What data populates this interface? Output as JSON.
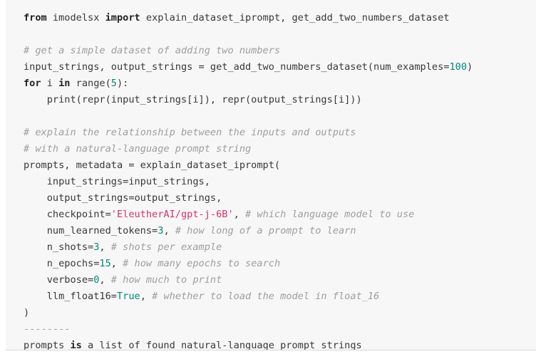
{
  "panel": {
    "background_color": "#f7f7f7",
    "page_background_color": "#ffffff",
    "border_color": "#d8d8d8",
    "language": "python"
  },
  "theme": {
    "text_color": "#383838",
    "keyword_color": "#222222",
    "string_color": "#d6336c",
    "number_color": "#00897b",
    "boolean_color": "#00897b",
    "comment_color": "#9e9e9e"
  },
  "code": {
    "lines": [
      {
        "index": 1,
        "text": "from imodelsx import explain_dataset_iprompt, get_add_two_numbers_dataset",
        "tokens": [
          {
            "t": "from",
            "k": "kw"
          },
          {
            "t": " imodelsx ",
            "k": "nm"
          },
          {
            "t": "import",
            "k": "kw"
          },
          {
            "t": " explain_dataset_iprompt, get_add_two_numbers_dataset",
            "k": "nm"
          }
        ]
      },
      {
        "index": 2,
        "text": "",
        "tokens": []
      },
      {
        "index": 3,
        "text": "# get a simple dataset of adding two numbers",
        "tokens": [
          {
            "t": "# get a simple dataset of adding two numbers",
            "k": "cmt"
          }
        ]
      },
      {
        "index": 4,
        "text": "input_strings, output_strings = get_add_two_numbers_dataset(num_examples=100)",
        "tokens": [
          {
            "t": "input_strings, output_strings = get_add_two_numbers_dataset(num_examples=",
            "k": "nm"
          },
          {
            "t": "100",
            "k": "num"
          },
          {
            "t": ")",
            "k": "nm"
          }
        ]
      },
      {
        "index": 5,
        "text": "for i in range(5):",
        "tokens": [
          {
            "t": "for",
            "k": "kw"
          },
          {
            "t": " i ",
            "k": "nm"
          },
          {
            "t": "in",
            "k": "kw"
          },
          {
            "t": " range(",
            "k": "nm"
          },
          {
            "t": "5",
            "k": "num"
          },
          {
            "t": "):",
            "k": "nm"
          }
        ]
      },
      {
        "index": 6,
        "text": "    print(repr(input_strings[i]), repr(output_strings[i]))",
        "tokens": [
          {
            "t": "    print(repr(input_strings[i]), repr(output_strings[i]))",
            "k": "nm"
          }
        ]
      },
      {
        "index": 7,
        "text": "",
        "tokens": []
      },
      {
        "index": 8,
        "text": "# explain the relationship between the inputs and outputs",
        "tokens": [
          {
            "t": "# explain the relationship between the inputs and outputs",
            "k": "cmt"
          }
        ]
      },
      {
        "index": 9,
        "text": "# with a natural-language prompt string",
        "tokens": [
          {
            "t": "# with a natural-language prompt string",
            "k": "cmt"
          }
        ]
      },
      {
        "index": 10,
        "text": "prompts, metadata = explain_dataset_iprompt(",
        "tokens": [
          {
            "t": "prompts, metadata = explain_dataset_iprompt(",
            "k": "nm"
          }
        ]
      },
      {
        "index": 11,
        "text": "    input_strings=input_strings,",
        "tokens": [
          {
            "t": "    input_strings=input_strings,",
            "k": "nm"
          }
        ]
      },
      {
        "index": 12,
        "text": "    output_strings=output_strings,",
        "tokens": [
          {
            "t": "    output_strings=output_strings,",
            "k": "nm"
          }
        ]
      },
      {
        "index": 13,
        "text": "    checkpoint='EleutherAI/gpt-j-6B', # which language model to use",
        "tokens": [
          {
            "t": "    checkpoint=",
            "k": "nm"
          },
          {
            "t": "'EleutherAI/gpt-j-6B'",
            "k": "str"
          },
          {
            "t": ", ",
            "k": "nm"
          },
          {
            "t": "# which language model to use",
            "k": "cmt"
          }
        ]
      },
      {
        "index": 14,
        "text": "    num_learned_tokens=3, # how long of a prompt to learn",
        "tokens": [
          {
            "t": "    num_learned_tokens=",
            "k": "nm"
          },
          {
            "t": "3",
            "k": "num"
          },
          {
            "t": ", ",
            "k": "nm"
          },
          {
            "t": "# how long of a prompt to learn",
            "k": "cmt"
          }
        ]
      },
      {
        "index": 15,
        "text": "    n_shots=3, # shots per example",
        "tokens": [
          {
            "t": "    n_shots=",
            "k": "nm"
          },
          {
            "t": "3",
            "k": "num"
          },
          {
            "t": ", ",
            "k": "nm"
          },
          {
            "t": "# shots per example",
            "k": "cmt"
          }
        ]
      },
      {
        "index": 16,
        "text": "    n_epochs=15, # how many epochs to search",
        "tokens": [
          {
            "t": "    n_epochs=",
            "k": "nm"
          },
          {
            "t": "15",
            "k": "num"
          },
          {
            "t": ", ",
            "k": "nm"
          },
          {
            "t": "# how many epochs to search",
            "k": "cmt"
          }
        ]
      },
      {
        "index": 17,
        "text": "    verbose=0, # how much to print",
        "tokens": [
          {
            "t": "    verbose=",
            "k": "nm"
          },
          {
            "t": "0",
            "k": "num"
          },
          {
            "t": ", ",
            "k": "nm"
          },
          {
            "t": "# how much to print",
            "k": "cmt"
          }
        ]
      },
      {
        "index": 18,
        "text": "    llm_float16=True, # whether to load the model in float_16",
        "tokens": [
          {
            "t": "    llm_float16=",
            "k": "nm"
          },
          {
            "t": "True",
            "k": "bln"
          },
          {
            "t": ", ",
            "k": "nm"
          },
          {
            "t": "# whether to load the model in float_16",
            "k": "cmt"
          }
        ]
      },
      {
        "index": 19,
        "text": ")",
        "tokens": [
          {
            "t": ")",
            "k": "nm"
          }
        ]
      },
      {
        "index": 20,
        "text": "--------",
        "tokens": [
          {
            "t": "--------",
            "k": "dash"
          }
        ]
      },
      {
        "index": 21,
        "text": "prompts is a list of found natural-language prompt strings",
        "tokens": [
          {
            "t": "prompts ",
            "k": "nm"
          },
          {
            "t": "is",
            "k": "kw"
          },
          {
            "t": " a list of found natural-language prompt strings",
            "k": "nm"
          }
        ]
      }
    ]
  }
}
